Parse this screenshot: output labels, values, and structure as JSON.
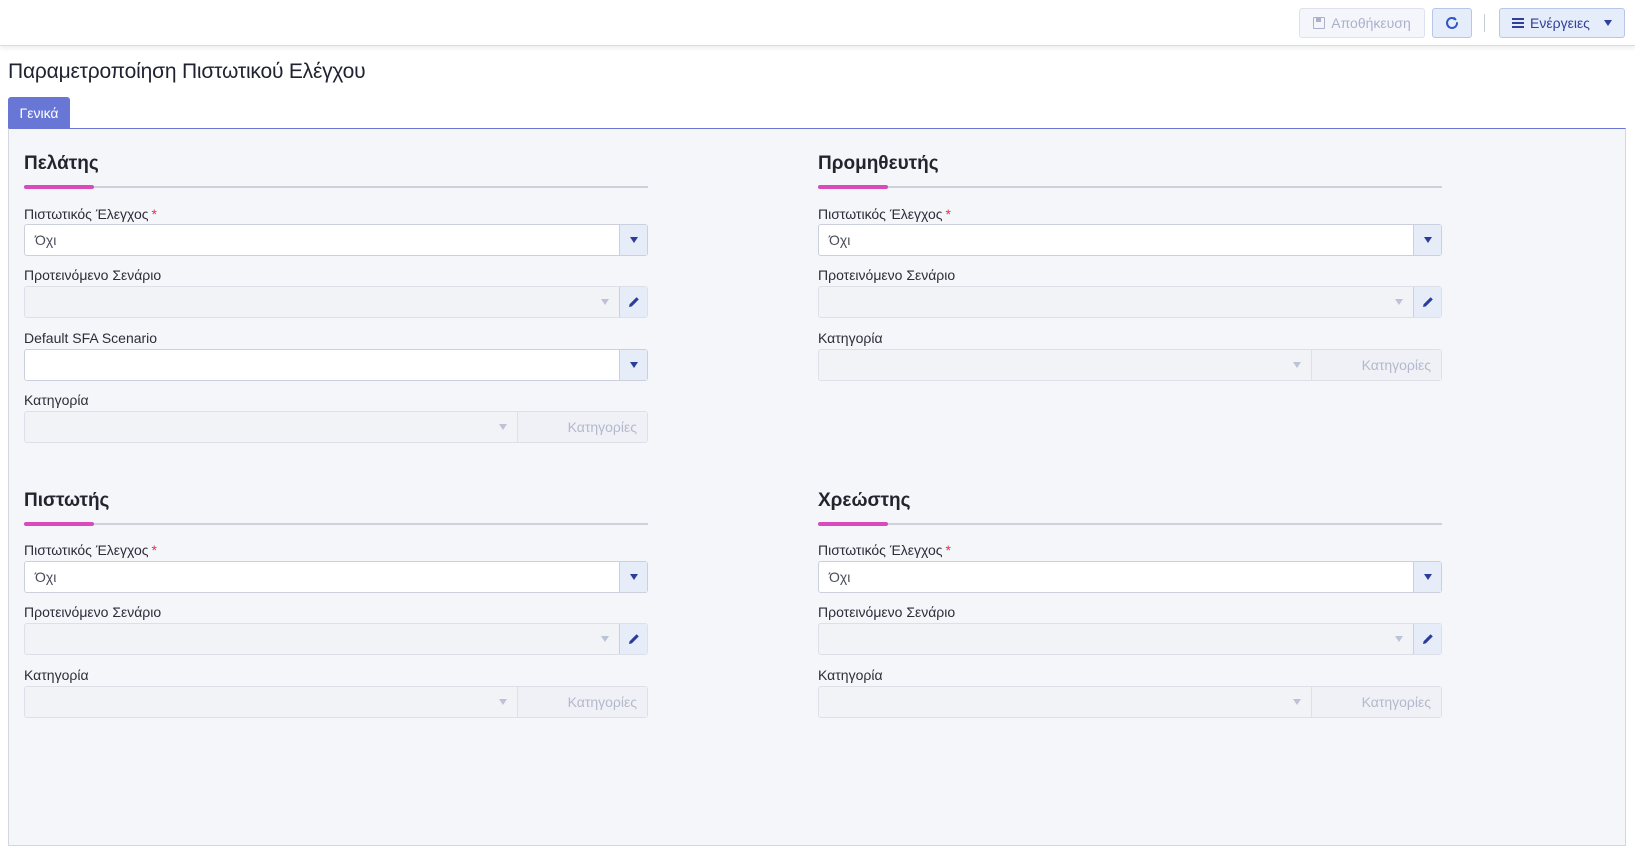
{
  "toolbar": {
    "save_label": "Αποθήκευση",
    "actions_label": "Ενέργειες"
  },
  "page": {
    "title": "Παραμετροποίηση Πιστωτικού Ελέγχου"
  },
  "tabs": [
    {
      "label": "Γενικά",
      "active": true
    }
  ],
  "labels": {
    "credit_check": "Πιστωτικός Έλεγχος",
    "required_mark": "*",
    "suggested_scenario": "Προτεινόμενο Σενάριο",
    "default_sfa": "Default SFA Scenario",
    "category": "Κατηγορία",
    "categories_button": "Κατηγορίες"
  },
  "sections": {
    "customer": {
      "title": "Πελάτης",
      "credit_check_value": "Όχι",
      "scenario_value": "",
      "sfa_value": "",
      "category_value": ""
    },
    "supplier": {
      "title": "Προμηθευτής",
      "credit_check_value": "Όχι",
      "scenario_value": "",
      "category_value": ""
    },
    "creditor": {
      "title": "Πιστωτής",
      "credit_check_value": "Όχι",
      "scenario_value": "",
      "category_value": ""
    },
    "debtor": {
      "title": "Χρεώστης",
      "credit_check_value": "Όχι",
      "scenario_value": "",
      "category_value": ""
    }
  },
  "colors": {
    "accent": "#6877d6",
    "section_underline": "#d94bbd",
    "required": "#e0334a"
  },
  "icons": {
    "save": "floppy-disk-icon",
    "refresh": "refresh-icon",
    "actions": "hamburger-menu-icon",
    "dropdown": "chevron-down-icon",
    "edit": "pencil-icon"
  }
}
